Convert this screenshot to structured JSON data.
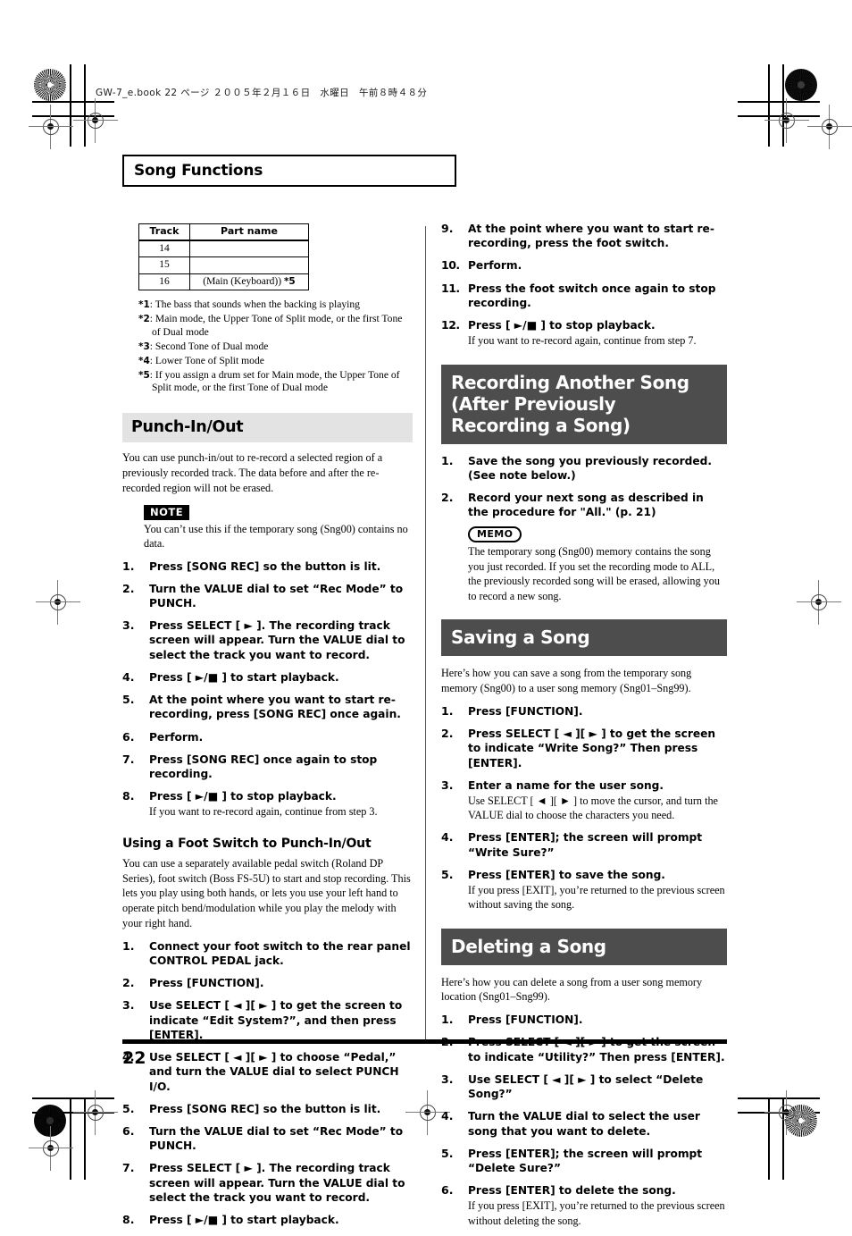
{
  "slug": "GW-7_e.book 22 ページ ２００５年２月１６日　水曜日　午前８時４８分",
  "chapter": {
    "title": "Song Functions"
  },
  "page_number": "22",
  "track_table": {
    "headers": [
      "Track",
      "Part name"
    ],
    "rows": [
      {
        "track": "14",
        "part": "",
        "sup": ""
      },
      {
        "track": "15",
        "part": "",
        "sup": ""
      },
      {
        "track": "16",
        "part": "(Main (Keyboard))",
        "sup": "*5"
      }
    ]
  },
  "footnotes": [
    {
      "mark": "*1",
      "text": ": The bass that sounds when the backing is playing"
    },
    {
      "mark": "*2",
      "text": ": Main mode, the Upper Tone of Split mode, or the first Tone of Dual mode"
    },
    {
      "mark": "*3",
      "text": ": Second Tone of Dual mode"
    },
    {
      "mark": "*4",
      "text": ": Lower Tone of Split mode"
    },
    {
      "mark": "*5",
      "text": ": If you assign a drum set for Main mode, the Upper Tone of Split mode, or the first Tone of Dual mode"
    }
  ],
  "punch": {
    "heading": "Punch-In/Out",
    "intro": "You can use punch-in/out to re-record a selected region of a previously recorded track. The data before and after the re-recorded region will not be erased.",
    "note_badge": "NOTE",
    "note_text": "You can’t use this if the temporary song (Sng00) contains no data.",
    "steps": [
      {
        "num": "1.",
        "main": "Press [SONG REC] so the button is lit.",
        "sub": ""
      },
      {
        "num": "2.",
        "main": "Turn the VALUE dial to set “Rec Mode” to PUNCH.",
        "sub": ""
      },
      {
        "num": "3.",
        "main": "Press SELECT [ ► ]. The recording track screen will appear. Turn the VALUE dial to select the track you want to record.",
        "sub": ""
      },
      {
        "num": "4.",
        "main": "Press [ ►/■ ] to start playback.",
        "sub": ""
      },
      {
        "num": "5.",
        "main": "At the point where you want to start re-recording, press [SONG REC] once again.",
        "sub": ""
      },
      {
        "num": "6.",
        "main": "Perform.",
        "sub": ""
      },
      {
        "num": "7.",
        "main": "Press [SONG REC] once again to stop recording.",
        "sub": ""
      },
      {
        "num": "8.",
        "main": "Press [ ►/■ ] to stop playback.",
        "sub": "If you want to re-record again, continue from step 3."
      }
    ]
  },
  "footswitch": {
    "heading": "Using a Foot Switch to Punch-In/Out",
    "intro": "You can use a separately available pedal switch (Roland DP Series), foot switch (Boss FS-5U) to start and stop recording. This lets you play using both hands, or lets you use your left hand to operate pitch bend/modulation while you play the melody with your right hand.",
    "steps_left": [
      {
        "num": "1.",
        "main": "Connect your foot switch to the rear panel CONTROL PEDAL jack.",
        "sub": ""
      },
      {
        "num": "2.",
        "main": "Press [FUNCTION].",
        "sub": ""
      },
      {
        "num": "3.",
        "main": "Use SELECT [ ◄ ][ ► ] to get the screen to indicate “Edit System?”, and then press [ENTER].",
        "sub": ""
      },
      {
        "num": "4.",
        "main": "Use SELECT [ ◄ ][ ► ] to choose “Pedal,” and turn the VALUE dial to select PUNCH I/O.",
        "sub": ""
      },
      {
        "num": "5.",
        "main": "Press [SONG REC] so the button is lit.",
        "sub": ""
      },
      {
        "num": "6.",
        "main": "Turn the VALUE dial to set “Rec Mode” to PUNCH.",
        "sub": ""
      },
      {
        "num": "7.",
        "main": "Press SELECT [ ► ]. The recording track screen will appear. Turn the VALUE dial to select the track you want to record.",
        "sub": ""
      },
      {
        "num": "8.",
        "main": "Press [ ►/■ ] to start playback.",
        "sub": ""
      }
    ],
    "steps_right": [
      {
        "num": "9.",
        "main": "At the point where you want to start re-recording, press the foot switch.",
        "sub": ""
      },
      {
        "num": "10.",
        "main": "Perform.",
        "sub": ""
      },
      {
        "num": "11.",
        "main": "Press the foot switch once again to stop recording.",
        "sub": ""
      },
      {
        "num": "12.",
        "main": "Press [ ►/■ ] to stop playback.",
        "sub": "If you want to re-record again, continue from step 7."
      }
    ]
  },
  "recording_another": {
    "heading": "Recording Another Song (After Previously Recording a Song)",
    "steps": [
      {
        "num": "1.",
        "main": "Save the song you previously recorded. (See note below.)",
        "sub": ""
      },
      {
        "num": "2.",
        "main": "Record your next song as described in the procedure for \"All.\" (p. 21)",
        "sub": ""
      }
    ],
    "memo_badge": "MEMO",
    "memo_text": "The temporary song (Sng00) memory contains the song you just recorded. If you set the recording mode to ALL, the previously recorded song will be erased, allowing you to record a new song."
  },
  "saving": {
    "heading": "Saving a Song",
    "intro": "Here’s how you can save a song from the temporary song memory (Sng00) to a user song memory (Sng01–Sng99).",
    "steps": [
      {
        "num": "1.",
        "main": "Press [FUNCTION].",
        "sub": ""
      },
      {
        "num": "2.",
        "main": "Press SELECT [ ◄ ][ ► ] to get the screen to indicate “Write Song?” Then press [ENTER].",
        "sub": ""
      },
      {
        "num": "3.",
        "main": "Enter a name for the user song.",
        "sub": "Use SELECT [ ◄ ][ ► ] to move the cursor, and turn the VALUE dial to choose the characters you need."
      },
      {
        "num": "4.",
        "main": "Press [ENTER]; the screen will prompt “Write Sure?”",
        "sub": ""
      },
      {
        "num": "5.",
        "main": "Press [ENTER] to save the song.",
        "sub": "If you press [EXIT], you’re returned to the previous screen without saving the song."
      }
    ]
  },
  "deleting": {
    "heading": "Deleting a Song",
    "intro": "Here’s how you can delete a song from a user song memory location (Sng01–Sng99).",
    "steps": [
      {
        "num": "1.",
        "main": "Press [FUNCTION].",
        "sub": ""
      },
      {
        "num": "2.",
        "main": "Press SELECT [ ◄ ][ ► ] to get the screen to indicate “Utility?” Then press [ENTER].",
        "sub": ""
      },
      {
        "num": "3.",
        "main": "Use SELECT [ ◄ ][ ► ] to select “Delete Song?”",
        "sub": ""
      },
      {
        "num": "4.",
        "main": "Turn the VALUE dial to select the user song that you want to delete.",
        "sub": ""
      },
      {
        "num": "5.",
        "main": "Press [ENTER]; the screen will prompt “Delete Sure?”",
        "sub": ""
      },
      {
        "num": "6.",
        "main": "Press [ENTER] to delete the song.",
        "sub": "If you press [EXIT], you’re returned to the previous screen without deleting the song."
      }
    ]
  }
}
